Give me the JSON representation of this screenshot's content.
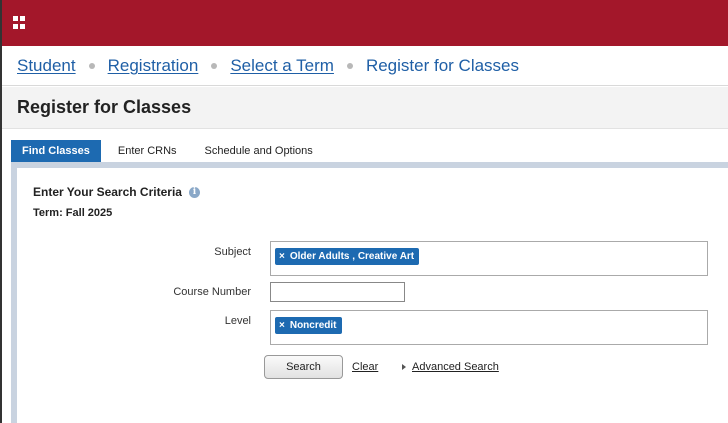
{
  "header": {
    "apps_icon": "apps-grid-icon",
    "brand_color": "#a3172a"
  },
  "breadcrumb": {
    "items": [
      {
        "label": "Student"
      },
      {
        "label": "Registration"
      },
      {
        "label": "Select a Term"
      }
    ],
    "current": "Register for Classes"
  },
  "page": {
    "title": "Register for Classes"
  },
  "tabs": [
    {
      "label": "Find Classes",
      "active": true
    },
    {
      "label": "Enter CRNs",
      "active": false
    },
    {
      "label": "Schedule and Options",
      "active": false
    }
  ],
  "search": {
    "title": "Enter Your Search Criteria",
    "info_icon": "info-icon",
    "term": "Term: Fall 2025",
    "subject": {
      "label": "Subject",
      "selected": [
        {
          "remove": "×",
          "value": "Older Adults , Creative Art"
        }
      ]
    },
    "course_number": {
      "label": "Course Number",
      "value": ""
    },
    "level": {
      "label": "Level",
      "selected": [
        {
          "remove": "×",
          "value": "Noncredit"
        }
      ]
    },
    "search_button": "Search",
    "clear_link": "Clear",
    "advanced_link": "Advanced Search"
  }
}
